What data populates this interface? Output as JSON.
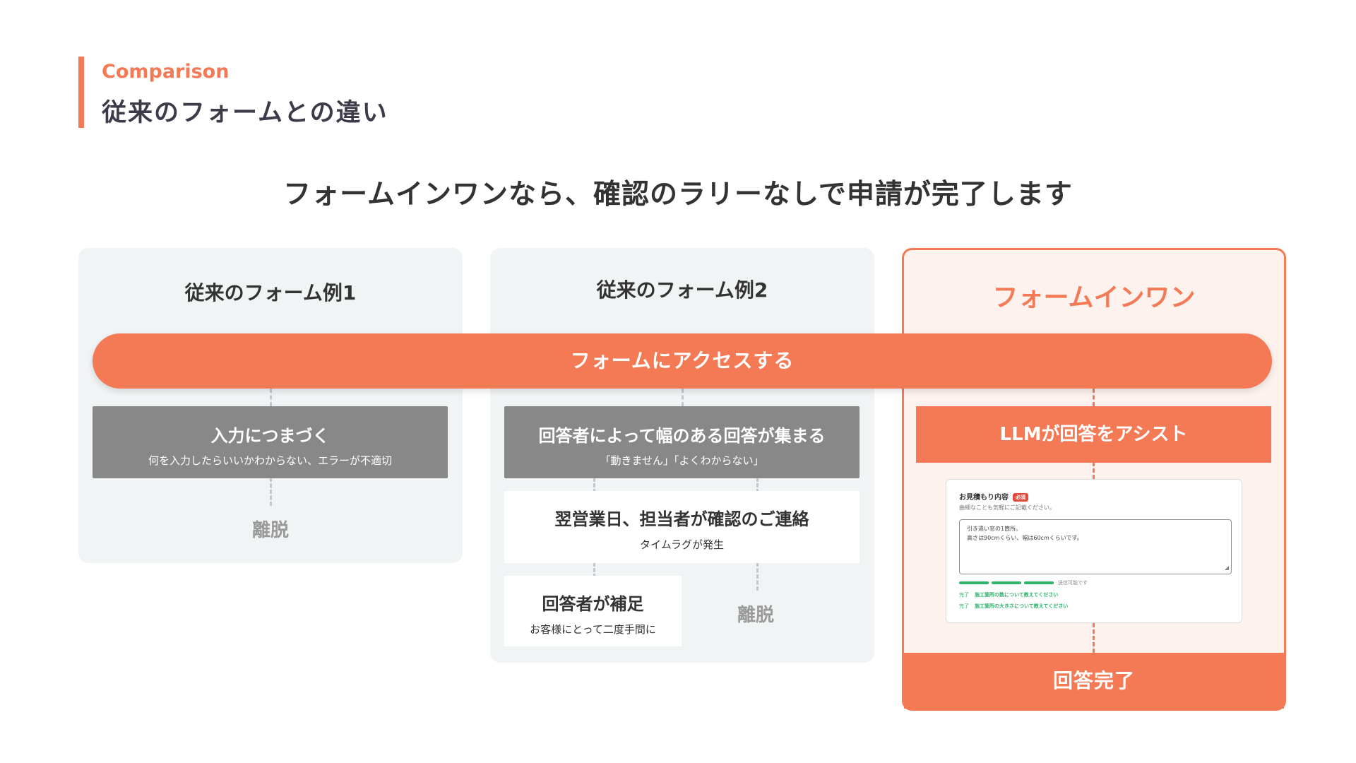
{
  "header": {
    "eyebrow": "Comparison",
    "title": "従来のフォームとの違い"
  },
  "headline": "フォームインワンなら、確認のラリーなしで申請が完了します",
  "access_bar": "フォームにアクセスする",
  "panel1": {
    "title": "従来のフォーム例1",
    "step1": {
      "main": "入力につまづく",
      "sub": "何を入力したらいいかわからない、エラーが不適切"
    },
    "exit": "離脱"
  },
  "panel2": {
    "title": "従来のフォーム例2",
    "step1": {
      "main": "回答者によって幅のある回答が集まる",
      "sub": "「動きません」「よくわからない」"
    },
    "step2": {
      "main": "翌営業日、担当者が確認のご連絡",
      "sub": "タイムラグが発生"
    },
    "step3": {
      "main": "回答者が補足",
      "sub": "お客様にとって二度手間に"
    },
    "exit": "離脱"
  },
  "panel3": {
    "title": "フォームインワン",
    "assist": "LLMが回答をアシスト",
    "mock": {
      "label": "お見積もり内容",
      "badge": "必須",
      "hint": "曲細なことも気軽にご記載ください。",
      "line1": "引き違い窓の1箇所。",
      "line2": "高さは90cmくらい、幅は60cmくらいです。",
      "status": "送信可能です",
      "check1_tag": "完了",
      "check1": "施工箇所の数について教えてください",
      "check2_tag": "完了",
      "check2": "施工箇所の大きさについて教えてください"
    },
    "done": "回答完了"
  },
  "colors": {
    "accent": "#f47a55",
    "panel_gray": "#f1f4f5",
    "box_gray": "#888888",
    "panel_orange_bg": "#fdf2ee",
    "success": "#2fb26a"
  }
}
